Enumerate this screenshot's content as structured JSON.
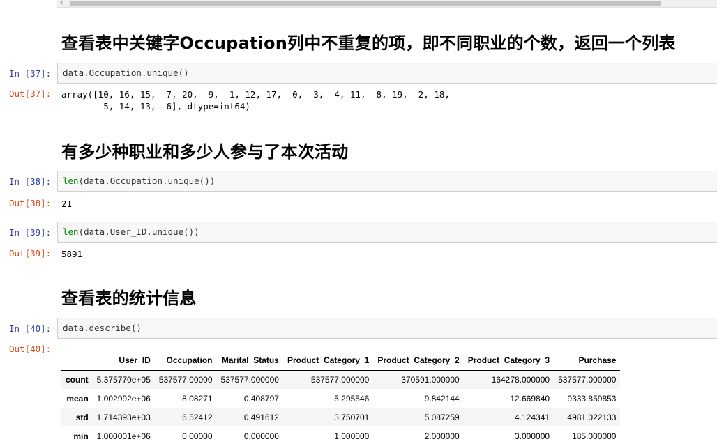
{
  "scrollbar": {
    "arrow": "‹"
  },
  "headings": {
    "h1": "查看表中关键字Occupation列中不重复的项，即不同职业的个数，返回一个列表",
    "h2": "有多少种职业和多少人参与了本次活动",
    "h3": "查看表的统计信息"
  },
  "cells": {
    "c37": {
      "in_prompt": "In [37]:",
      "code": "data.Occupation.unique()",
      "out_prompt": "Out[37]:",
      "output": "array([10, 16, 15,  7, 20,  9,  1, 12, 17,  0,  3,  4, 11,  8, 19,  2, 18,\n        5, 14, 13,  6], dtype=int64)"
    },
    "c38": {
      "in_prompt": "In [38]:",
      "code_fn": "len",
      "code_rest": "(data.Occupation.unique())",
      "out_prompt": "Out[38]:",
      "output": "21"
    },
    "c39": {
      "in_prompt": "In [39]:",
      "code_fn": "len",
      "code_rest": "(data.User_ID.unique())",
      "out_prompt": "Out[39]:",
      "output": "5891"
    },
    "c40": {
      "in_prompt": "In [40]:",
      "code": "data.describe()",
      "out_prompt": "Out[40]:"
    }
  },
  "describe_table": {
    "columns": [
      "",
      "User_ID",
      "Occupation",
      "Marital_Status",
      "Product_Category_1",
      "Product_Category_2",
      "Product_Category_3",
      "Purchase"
    ],
    "rows": [
      [
        "count",
        "5.375770e+05",
        "537577.00000",
        "537577.000000",
        "537577.000000",
        "370591.000000",
        "164278.000000",
        "537577.000000"
      ],
      [
        "mean",
        "1.002992e+06",
        "8.08271",
        "0.408797",
        "5.295546",
        "9.842144",
        "12.669840",
        "9333.859853"
      ],
      [
        "std",
        "1.714393e+03",
        "6.52412",
        "0.491612",
        "3.750701",
        "5.087259",
        "4.124341",
        "4981.022133"
      ],
      [
        "min",
        "1.000001e+06",
        "0.00000",
        "0.000000",
        "1.000000",
        "2.000000",
        "3.000000",
        "185.000000"
      ]
    ]
  }
}
